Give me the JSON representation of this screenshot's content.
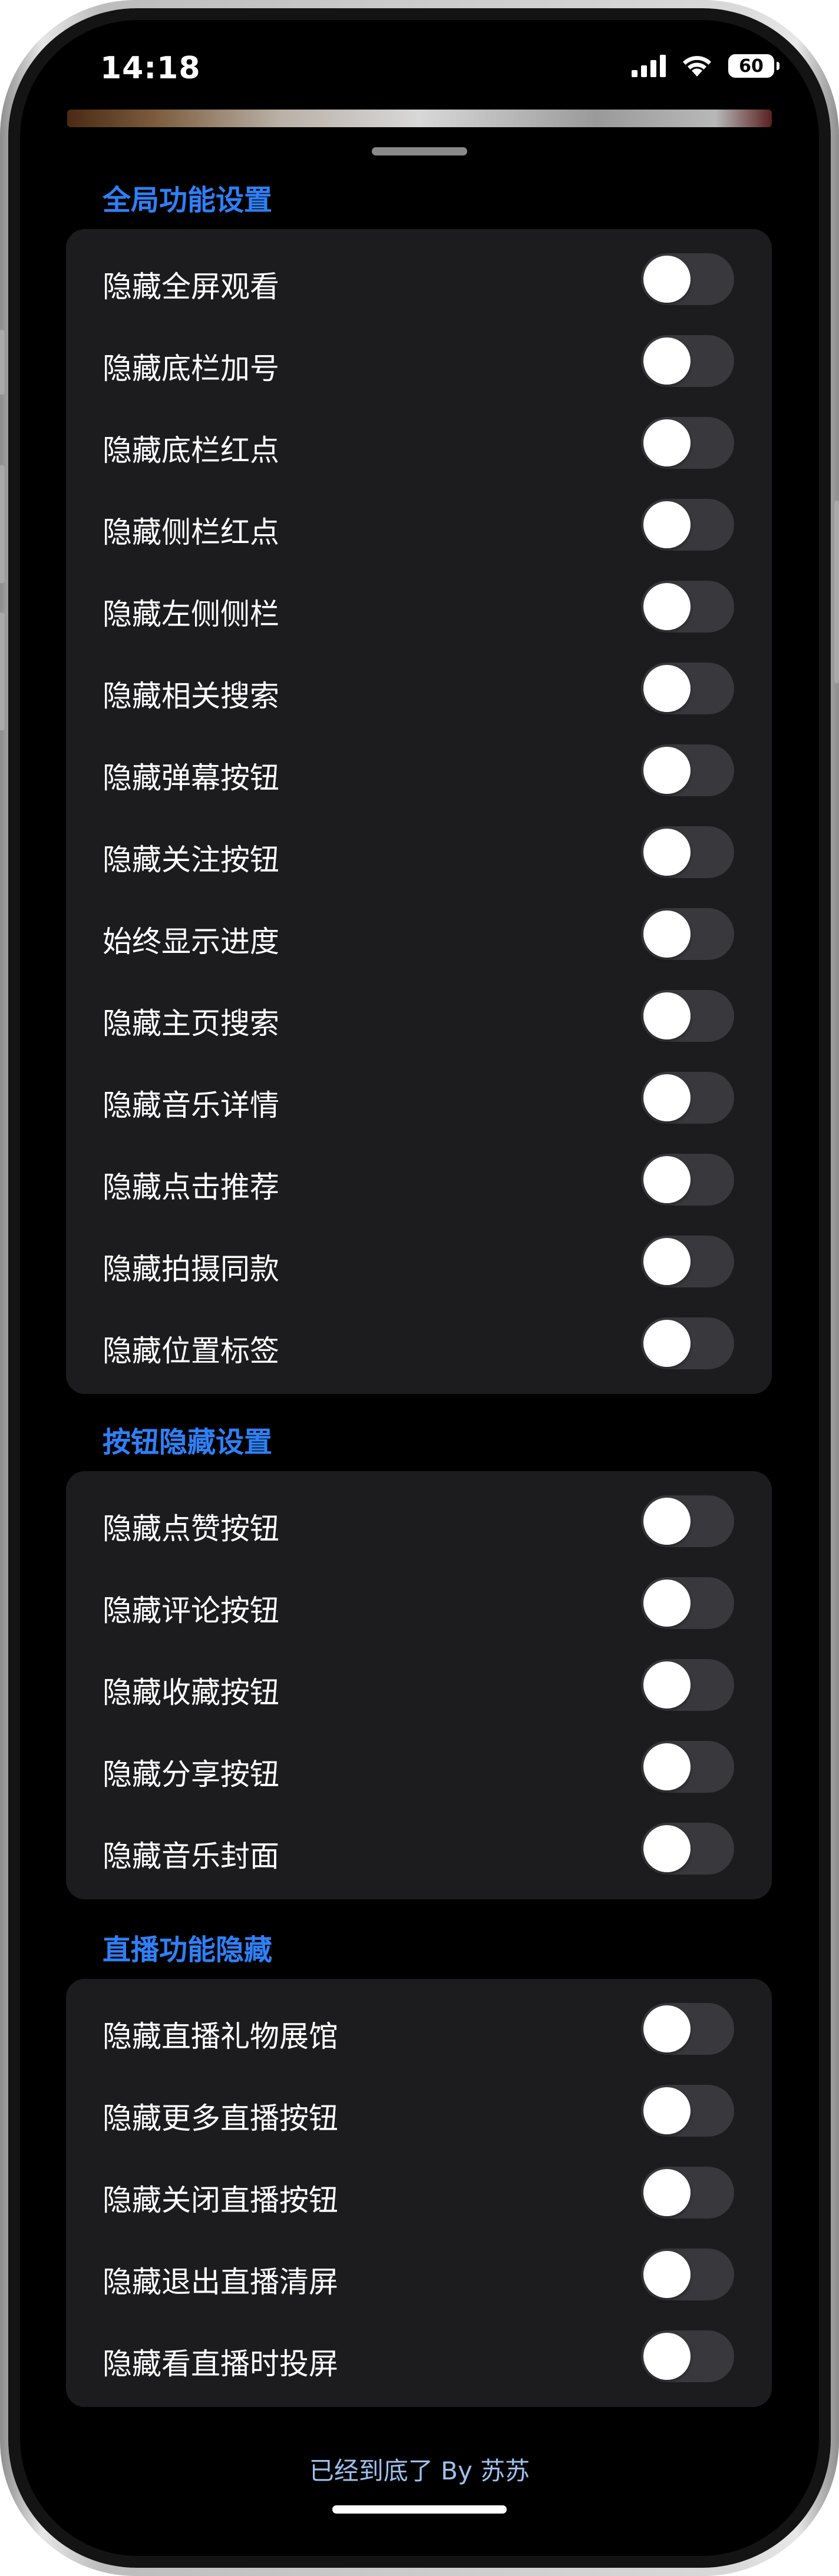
{
  "status_bar": {
    "time": "14:18",
    "battery": "60",
    "icons": [
      "signal-bars-icon",
      "wifi-icon",
      "battery-icon"
    ]
  },
  "colors": {
    "accent": "#2f80f6",
    "card": "#1c1c1e",
    "toggle_off": "#39393d",
    "footer": "#9cc1ee"
  },
  "sections": [
    {
      "title": "全局功能设置",
      "items": [
        {
          "label": "隐藏全屏观看",
          "on": false
        },
        {
          "label": "隐藏底栏加号",
          "on": false
        },
        {
          "label": "隐藏底栏红点",
          "on": false
        },
        {
          "label": "隐藏侧栏红点",
          "on": false
        },
        {
          "label": "隐藏左侧侧栏",
          "on": false
        },
        {
          "label": "隐藏相关搜索",
          "on": false
        },
        {
          "label": "隐藏弹幕按钮",
          "on": false
        },
        {
          "label": "隐藏关注按钮",
          "on": false
        },
        {
          "label": "始终显示进度",
          "on": false
        },
        {
          "label": "隐藏主页搜索",
          "on": false
        },
        {
          "label": "隐藏音乐详情",
          "on": false
        },
        {
          "label": "隐藏点击推荐",
          "on": false
        },
        {
          "label": "隐藏拍摄同款",
          "on": false
        },
        {
          "label": "隐藏位置标签",
          "on": false
        }
      ]
    },
    {
      "title": "按钮隐藏设置",
      "items": [
        {
          "label": "隐藏点赞按钮",
          "on": false
        },
        {
          "label": "隐藏评论按钮",
          "on": false
        },
        {
          "label": "隐藏收藏按钮",
          "on": false
        },
        {
          "label": "隐藏分享按钮",
          "on": false
        },
        {
          "label": "隐藏音乐封面",
          "on": false
        }
      ]
    },
    {
      "title": "直播功能隐藏",
      "items": [
        {
          "label": "隐藏直播礼物展馆",
          "on": false
        },
        {
          "label": "隐藏更多直播按钮",
          "on": false
        },
        {
          "label": "隐藏关闭直播按钮",
          "on": false
        },
        {
          "label": "隐藏退出直播清屏",
          "on": false
        },
        {
          "label": "隐藏看直播时投屏",
          "on": false
        }
      ]
    }
  ],
  "footer": "已经到底了 By 苏苏"
}
